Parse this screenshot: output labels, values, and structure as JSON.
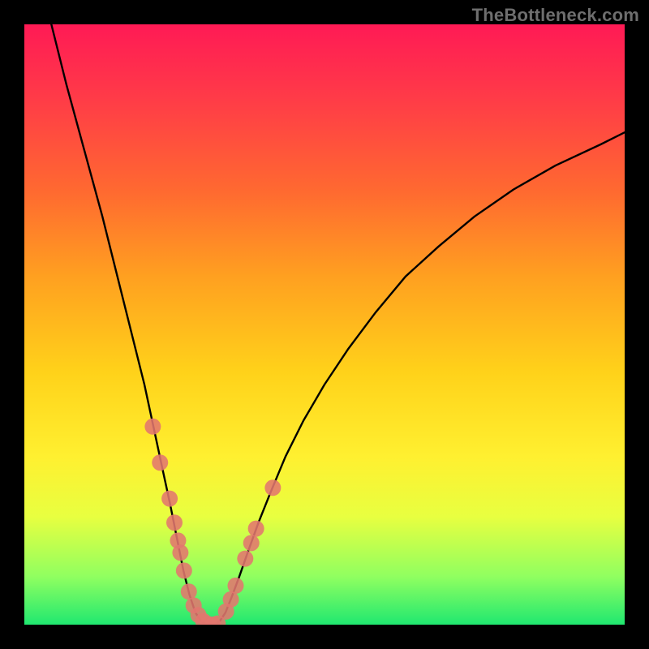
{
  "watermark": "TheBottleneck.com",
  "chart_data": {
    "type": "line",
    "title": "",
    "xlabel": "",
    "ylabel": "",
    "xlim": [
      0,
      100
    ],
    "ylim": [
      0,
      100
    ],
    "background_gradient": {
      "top": "#ff1a55",
      "bottom": "#20e870"
    },
    "series": [
      {
        "name": "bottleneck-curve",
        "color": "#000000",
        "points": [
          {
            "x": 4.5,
            "y": 100
          },
          {
            "x": 7,
            "y": 90
          },
          {
            "x": 10,
            "y": 79
          },
          {
            "x": 13,
            "y": 68
          },
          {
            "x": 15.5,
            "y": 58
          },
          {
            "x": 18,
            "y": 48
          },
          {
            "x": 20,
            "y": 40
          },
          {
            "x": 21.5,
            "y": 33
          },
          {
            "x": 23,
            "y": 26
          },
          {
            "x": 24.3,
            "y": 20
          },
          {
            "x": 25.5,
            "y": 14
          },
          {
            "x": 26.5,
            "y": 9
          },
          {
            "x": 27.5,
            "y": 5
          },
          {
            "x": 28.5,
            "y": 2
          },
          {
            "x": 29.5,
            "y": 0.5
          },
          {
            "x": 30.5,
            "y": 0
          },
          {
            "x": 31.5,
            "y": 0
          },
          {
            "x": 32.5,
            "y": 0.5
          },
          {
            "x": 33.5,
            "y": 2
          },
          {
            "x": 34.5,
            "y": 4.5
          },
          {
            "x": 35.8,
            "y": 8
          },
          {
            "x": 37.2,
            "y": 12
          },
          {
            "x": 39,
            "y": 17
          },
          {
            "x": 41,
            "y": 22
          },
          {
            "x": 43.5,
            "y": 28
          },
          {
            "x": 46.5,
            "y": 34
          },
          {
            "x": 50,
            "y": 40
          },
          {
            "x": 54,
            "y": 46
          },
          {
            "x": 58.5,
            "y": 52
          },
          {
            "x": 63.5,
            "y": 58
          },
          {
            "x": 69,
            "y": 63
          },
          {
            "x": 75,
            "y": 68
          },
          {
            "x": 81.5,
            "y": 72.5
          },
          {
            "x": 88.5,
            "y": 76.5
          },
          {
            "x": 96,
            "y": 80
          },
          {
            "x": 100,
            "y": 82
          }
        ]
      },
      {
        "name": "left-branch-markers",
        "color": "#e2766e",
        "marker_radius": 10,
        "points": [
          {
            "x": 21.4,
            "y": 33
          },
          {
            "x": 22.6,
            "y": 27
          },
          {
            "x": 24.2,
            "y": 21
          },
          {
            "x": 25.0,
            "y": 17
          },
          {
            "x": 25.6,
            "y": 14
          },
          {
            "x": 26.0,
            "y": 12
          },
          {
            "x": 26.6,
            "y": 9
          },
          {
            "x": 27.4,
            "y": 5.5
          },
          {
            "x": 28.2,
            "y": 3.2
          },
          {
            "x": 29.0,
            "y": 1.6
          },
          {
            "x": 29.8,
            "y": 0.6
          },
          {
            "x": 30.6,
            "y": 0.1
          },
          {
            "x": 31.4,
            "y": 0.0
          },
          {
            "x": 32.2,
            "y": 0.2
          }
        ]
      },
      {
        "name": "right-branch-markers",
        "color": "#e2766e",
        "marker_radius": 10,
        "points": [
          {
            "x": 33.6,
            "y": 2.2
          },
          {
            "x": 34.4,
            "y": 4.2
          },
          {
            "x": 35.2,
            "y": 6.5
          },
          {
            "x": 36.8,
            "y": 11
          },
          {
            "x": 37.8,
            "y": 13.6
          },
          {
            "x": 38.6,
            "y": 16
          },
          {
            "x": 41.4,
            "y": 22.8
          }
        ]
      }
    ]
  }
}
